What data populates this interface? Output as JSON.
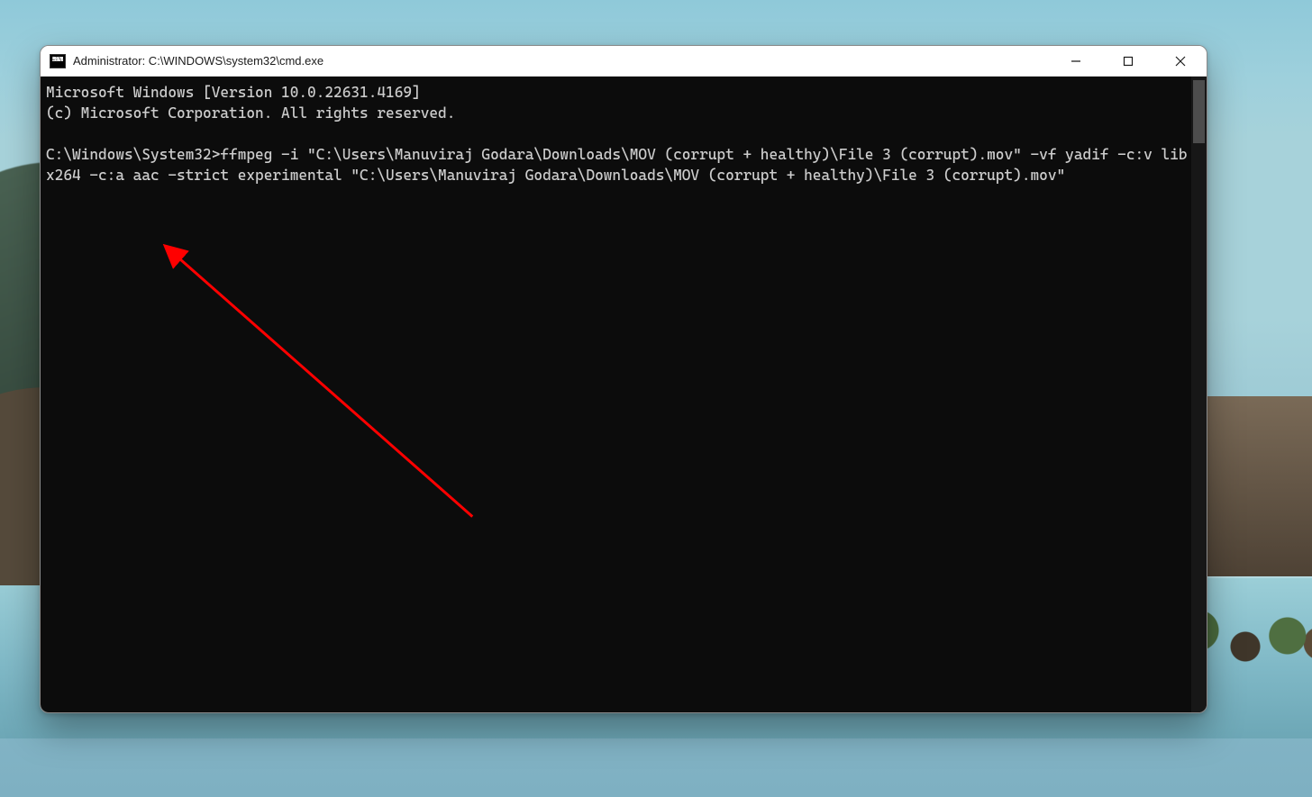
{
  "window": {
    "title": "Administrator: C:\\WINDOWS\\system32\\cmd.exe",
    "icon_label": "C:\\."
  },
  "terminal": {
    "line_version": "Microsoft Windows [Version 10.0.22631.4169]",
    "line_copyright": "(c) Microsoft Corporation. All rights reserved.",
    "prompt_path": "C:\\Windows\\System32>",
    "command": "ffmpeg -i \"C:\\Users\\Manuviraj Godara\\Downloads\\MOV (corrupt + healthy)\\File 3 (corrupt).mov\" -vf yadif -c:v libx264 -c:a aac -strict experimental \"C:\\Users\\Manuviraj Godara\\Downloads\\MOV (corrupt + healthy)\\File 3 (corrupt).mov\""
  },
  "annotation": {
    "arrow_color": "#ff0000"
  }
}
